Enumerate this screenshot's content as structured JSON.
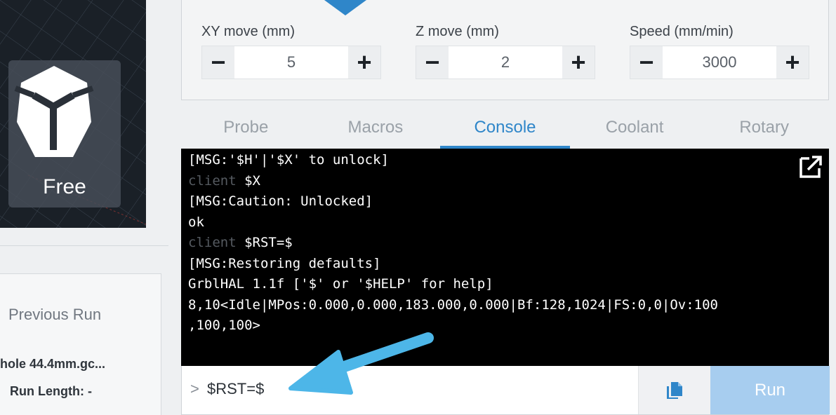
{
  "left": {
    "preset_label": "Free",
    "previous_run": {
      "title": "Previous Run",
      "file": "hole 44.4mm.gc...",
      "run_length": "Run Length: -"
    }
  },
  "jog": {
    "xy": {
      "label": "XY move (mm)",
      "value": "5",
      "minus": "−",
      "plus": "+"
    },
    "z": {
      "label": "Z move (mm)",
      "value": "2",
      "minus": "−",
      "plus": "+"
    },
    "speed": {
      "label": "Speed (mm/min)",
      "value": "3000",
      "minus": "−",
      "plus": "+"
    }
  },
  "tabs": [
    {
      "label": "Probe",
      "active": false
    },
    {
      "label": "Macros",
      "active": false
    },
    {
      "label": "Console",
      "active": true
    },
    {
      "label": "Coolant",
      "active": false
    },
    {
      "label": "Rotary",
      "active": false
    }
  ],
  "console": {
    "lines": [
      {
        "prefix": "",
        "text": "[MSG:'$H'|'$X' to unlock]"
      },
      {
        "prefix": "client ",
        "text": "$X"
      },
      {
        "prefix": "",
        "text": "[MSG:Caution: Unlocked]"
      },
      {
        "prefix": "",
        "text": "ok"
      },
      {
        "prefix": "client ",
        "text": "$RST=$"
      },
      {
        "prefix": "",
        "text": "[MSG:Restoring defaults]"
      },
      {
        "prefix": "",
        "text": "GrblHAL 1.1f ['$' or '$HELP' for help]"
      },
      {
        "prefix": "",
        "text": "8,10<Idle|MPos:0.000,0.000,183.000,0.000|Bf:128,1024|FS:0,0|Ov:100"
      },
      {
        "prefix": "",
        "text": ",100,100>"
      }
    ],
    "popout_icon": "external-link-icon"
  },
  "command": {
    "prompt": ">",
    "value": "$RST=$",
    "copy_icon": "copy-icon",
    "run_label": "Run"
  },
  "colors": {
    "accent": "#2f86c9",
    "run_button": "#a7cdef",
    "annotation_arrow": "#4db6e8",
    "console_bg": "#000000"
  }
}
